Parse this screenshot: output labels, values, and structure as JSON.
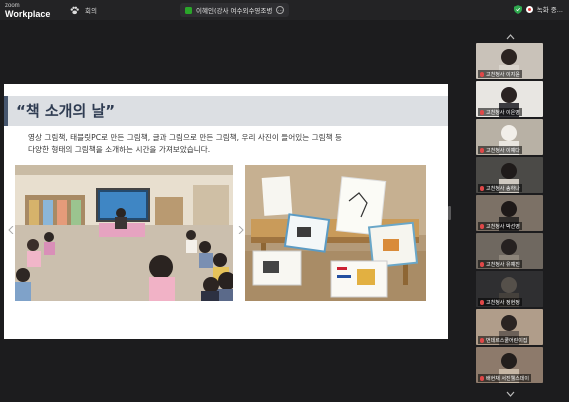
{
  "app": {
    "logo_top": "zoom",
    "logo_bottom": "Workplace"
  },
  "meeting": {
    "label": "회의"
  },
  "share": {
    "label": "이혜인(강사 여수외수영조병"
  },
  "recording": {
    "label": "녹화 중..."
  },
  "slide": {
    "title": "“책 소개의 날”",
    "desc_line1": "영상 그림책, 태블릿PC로 만든 그림책, 글과 그림으로 만든 그림책, 우리 사진이 들어있는 그림책 등",
    "desc_line2": "다양한 형태의 그림책을 소개하는 시간을 가져보았습니다.",
    "photo_left_desc": "classroom-children-circle-time",
    "photo_right_desc": "picture-books-on-table",
    "accent_color": "#46566e"
  },
  "participants": [
    {
      "name": "고천청사 이지윤",
      "bg": "#c9c2b9"
    },
    {
      "name": "고천청사 이은영",
      "bg": "#e8e6e2"
    },
    {
      "name": "고천청사 이예다",
      "bg": "#b8b1a5"
    },
    {
      "name": "고천청사 송하나",
      "bg": "#4b4a47"
    },
    {
      "name": "고천청사 박선영",
      "bg": "#7c7166"
    },
    {
      "name": "고천청사 유예진",
      "bg": "#6f6860"
    },
    {
      "name": "고천청사 정현정",
      "bg": "#2f2f31"
    },
    {
      "name": "번데르스쿨어린이집",
      "bg": "#b09d8a"
    },
    {
      "name": "배현채 서진웰스데이",
      "bg": "#8d7a6b"
    }
  ],
  "icons": {
    "top": [
      "paw-icon",
      "share-screen-icon",
      "more-icon",
      "shield-icon",
      "record-icon"
    ],
    "strip": [
      "chevron-up-icon",
      "chevron-down-icon"
    ]
  }
}
